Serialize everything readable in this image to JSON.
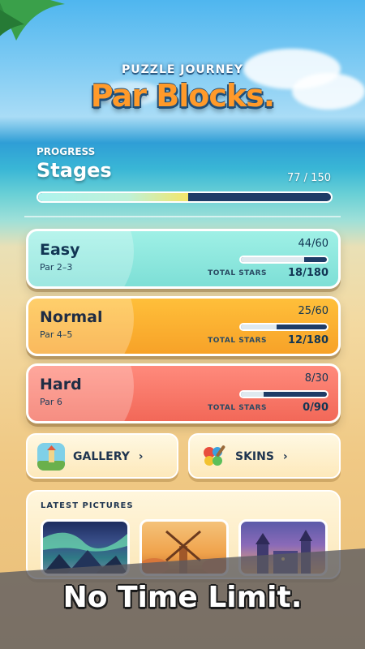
{
  "header": {
    "subtitle": "PUZZLE JOURNEY",
    "logo": "Par Blocks."
  },
  "progress": {
    "label": "PROGRESS",
    "heading": "Stages",
    "count": "77 / 150",
    "fraction": 0.513
  },
  "levels": [
    {
      "name": "Easy",
      "par": "Par 2–3",
      "count": "44/60",
      "fraction": 0.733,
      "stars_label": "TOTAL STARS",
      "stars": "18/180"
    },
    {
      "name": "Normal",
      "par": "Par 4–5",
      "count": "25/60",
      "fraction": 0.417,
      "stars_label": "TOTAL STARS",
      "stars": "12/180"
    },
    {
      "name": "Hard",
      "par": "Par 6",
      "count": "8/30",
      "fraction": 0.267,
      "stars_label": "TOTAL STARS",
      "stars": "0/90"
    }
  ],
  "buttons": {
    "gallery": "GALLERY",
    "skins": "SKINS",
    "chevron": "›"
  },
  "latest": {
    "heading": "LATEST PICTURES",
    "thumbnails": [
      "aurora-night",
      "windmill-autumn",
      "castle-sunset"
    ]
  },
  "banner": {
    "text": "No Time Limit."
  },
  "colors": {
    "easy": "#8ee8df",
    "normal": "#fbb131",
    "hard": "#f7786a",
    "bar_dark": "#1e3c67",
    "logo_orange": "#ff9a2a"
  }
}
